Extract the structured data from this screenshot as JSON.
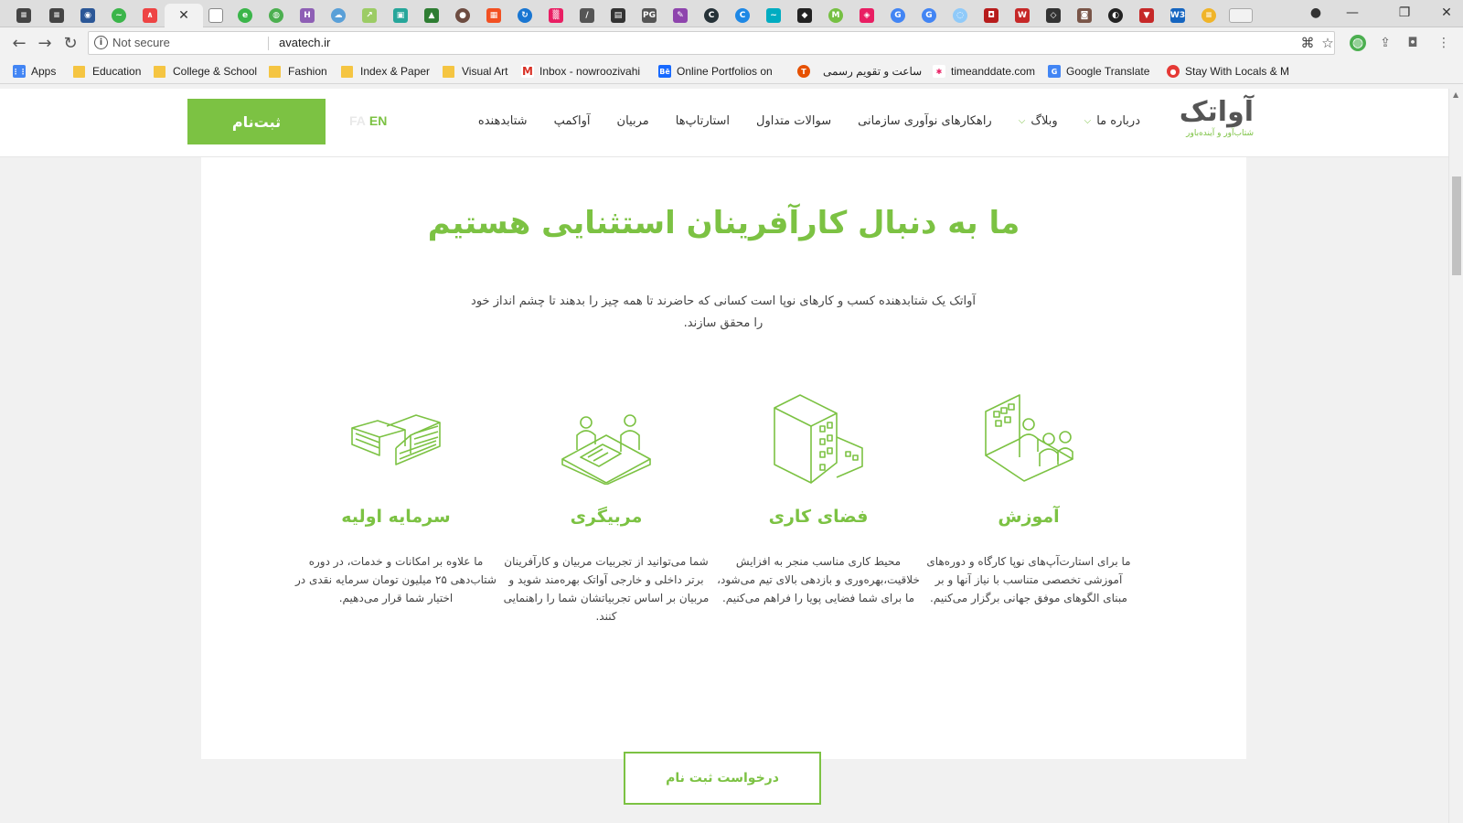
{
  "browser": {
    "address": {
      "secure_label": "Not secure",
      "url": "avatech.ir"
    },
    "bookmarks": [
      {
        "label": "Apps"
      },
      {
        "label": "Education"
      },
      {
        "label": "College & School"
      },
      {
        "label": "Fashion"
      },
      {
        "label": "Index & Paper"
      },
      {
        "label": "Visual Art"
      },
      {
        "label": "Inbox - nowroozivahi"
      },
      {
        "label": "Online Portfolios on"
      },
      {
        "label": "ساعت و تقویم رسمی"
      },
      {
        "label": "timeanddate.com"
      },
      {
        "label": "Google Translate"
      },
      {
        "label": "Stay With Locals & M"
      }
    ]
  },
  "header": {
    "logo_text": "آواتک",
    "logo_tagline": "شتاب‌آور و آینده‌باور",
    "menu": [
      {
        "label": "شتابدهنده"
      },
      {
        "label": "آواکمپ"
      },
      {
        "label": "مربیان"
      },
      {
        "label": "استارتاپ‌ها"
      },
      {
        "label": "سوالات متداول"
      },
      {
        "label": "راهکارهای نوآوری سازمانی"
      },
      {
        "label": "وبلاگ"
      },
      {
        "label": "درباره ما"
      }
    ],
    "lang_fa": "FA",
    "lang_en": "EN",
    "signup": "ثبت‌نام"
  },
  "hero": {
    "title": "ما به دنبال کارآفرینان استثنایی هستیم",
    "description": "آواتک یک شتابدهنده کسب و کارهای نوپا است کسانی که حاضرند تا همه چیز را بدهند تا چشم انداز خود را محقق سازند."
  },
  "features": [
    {
      "icon": "training-icon",
      "title": "آموزش",
      "text": "ما برای استارت‌آپ‌های نوپا کارگاه و دوره‌های آموزشی تخصصی متناسب با نیاز آنها و بر مبنای الگوهای موفق جهانی برگزار می‌کنیم."
    },
    {
      "icon": "workspace-icon",
      "title": "فضای کاری",
      "text": "محیط کاری مناسب منجر به افزایش خلاقیت،بهره‌وری و بازدهی بالای تیم می‌شود، ما برای شما فضایی پویا را فراهم می‌کنیم."
    },
    {
      "icon": "mentoring-icon",
      "title": "مربیگری",
      "text": "شما می‌توانید از تجربیات مربیان و کارآفرینان برتر داخلی و خارجی آواتک بهره‌مند شوید و مربیان بر اساس تجربیاتشان شما را راهنمایی کنند."
    },
    {
      "icon": "money-icon",
      "title": "سرمایه اولیه",
      "text": "ما علاوه بر امکانات و خدمات، در دوره شتاب‌دهی ۲۵ میلیون تومان سرمایه نقدی در اختیار شما قرار می‌دهیم."
    }
  ],
  "cta": {
    "label": "درخواست ثبت نام"
  },
  "colors": {
    "brand": "#7cc243",
    "text": "#444444",
    "background": "#f1f1f1"
  }
}
